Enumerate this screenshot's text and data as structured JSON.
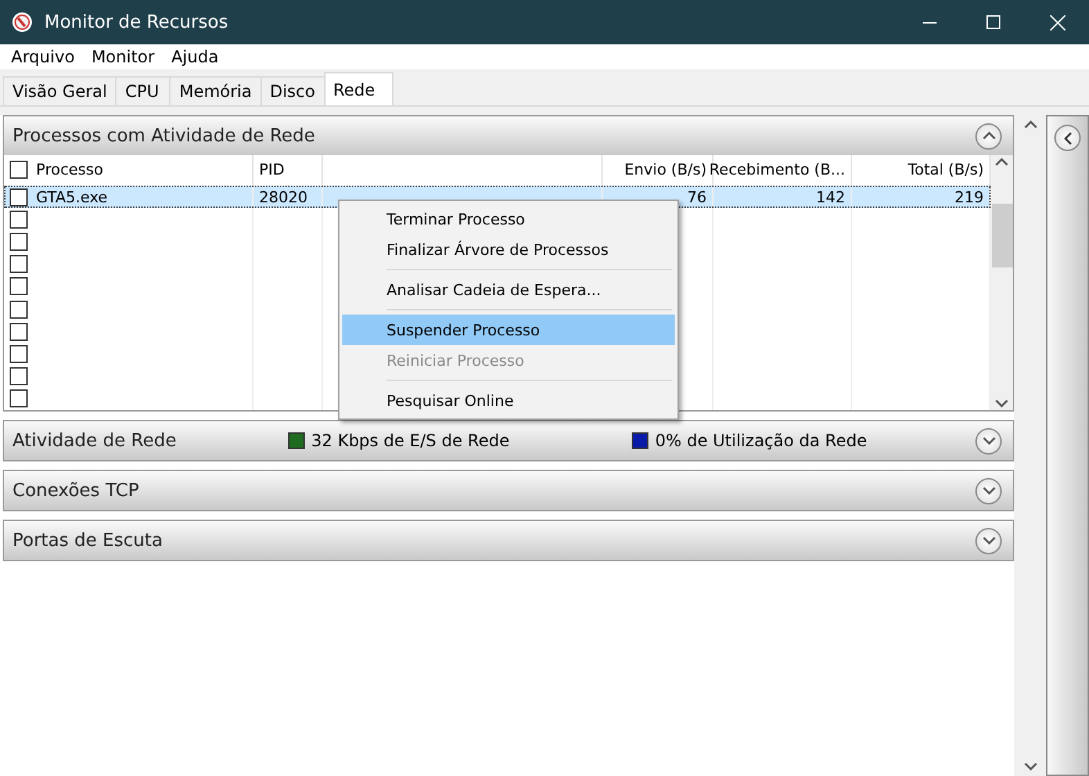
{
  "window": {
    "title": "Monitor de Recursos"
  },
  "menu": [
    "Arquivo",
    "Monitor",
    "Ajuda"
  ],
  "tabs": [
    {
      "label": "Visão Geral",
      "selected": false
    },
    {
      "label": "CPU",
      "selected": false
    },
    {
      "label": "Memória",
      "selected": false
    },
    {
      "label": "Disco",
      "selected": false
    },
    {
      "label": "Rede",
      "selected": true
    }
  ],
  "sections": [
    {
      "title": "Processos com Atividade de Rede",
      "expanded": true,
      "table": {
        "all_checked": false,
        "columns": [
          "Processo",
          "PID",
          "Envio (B/s)",
          "Recebimento (B...",
          "Total (B/s)"
        ],
        "rows": [
          {
            "checked": false,
            "selected": true,
            "cells": [
              "GTA5.exe",
              "28020",
              "76",
              "142",
              "219"
            ]
          },
          {
            "checked": false,
            "selected": false
          },
          {
            "checked": false,
            "selected": false
          },
          {
            "checked": false,
            "selected": false
          },
          {
            "checked": false,
            "selected": false
          },
          {
            "checked": false,
            "selected": false
          },
          {
            "checked": false,
            "selected": false
          },
          {
            "checked": false,
            "selected": false
          },
          {
            "checked": false,
            "selected": false
          },
          {
            "checked": false,
            "selected": false
          }
        ]
      }
    },
    {
      "title": "Atividade de Rede",
      "expanded": false,
      "legend": [
        {
          "label": "32 Kbps de E/S de Rede",
          "color": "#1f6b1f"
        },
        {
          "label": "0% de Utilização da Rede",
          "color": "#0a1aa8"
        }
      ]
    },
    {
      "title": "Conexões TCP",
      "expanded": false
    },
    {
      "title": "Portas de Escuta",
      "expanded": false
    }
  ],
  "context_menu": [
    {
      "kind": "item",
      "label": "Terminar Processo",
      "selected": false,
      "disabled": false
    },
    {
      "kind": "item",
      "label": "Finalizar Árvore de Processos",
      "selected": false,
      "disabled": false
    },
    {
      "kind": "separator"
    },
    {
      "kind": "item",
      "label": "Analisar Cadeia de Espera...",
      "selected": false,
      "disabled": false
    },
    {
      "kind": "separator"
    },
    {
      "kind": "item",
      "label": "Suspender Processo",
      "selected": true,
      "disabled": false
    },
    {
      "kind": "item",
      "label": "Reiniciar Processo",
      "selected": false,
      "disabled": true
    },
    {
      "kind": "separator"
    },
    {
      "kind": "item",
      "label": "Pesquisar Online",
      "selected": false,
      "disabled": false
    }
  ]
}
